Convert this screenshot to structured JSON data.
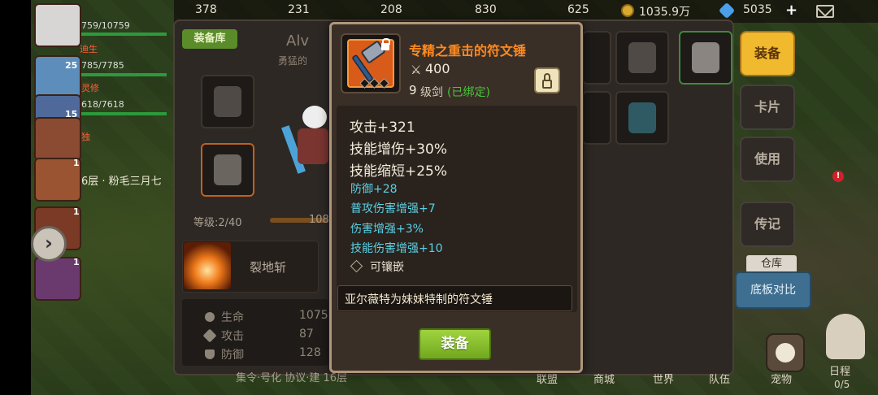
{
  "resources": [
    {
      "name": "resource-1",
      "value": "378"
    },
    {
      "name": "resource-2",
      "value": "231"
    },
    {
      "name": "resource-3",
      "value": "208"
    },
    {
      "name": "resource-4",
      "value": "830"
    },
    {
      "name": "resource-5",
      "value": "625"
    },
    {
      "name": "gold",
      "value": "1035.9万"
    },
    {
      "name": "diamonds",
      "value": "5035"
    }
  ],
  "team": [
    {
      "level": "",
      "hp": "759/10759",
      "name": ""
    },
    {
      "level": "25",
      "hp": "785/7785",
      "name": ""
    },
    {
      "level": "",
      "hp": "618/7618",
      "name": ""
    },
    {
      "level": "15",
      "hp": "",
      "name": ""
    },
    {
      "level": "1",
      "hp": "",
      "name": ""
    },
    {
      "level": "1",
      "hp": "",
      "name": ""
    },
    {
      "level": "1",
      "hp": "",
      "name": ""
    }
  ],
  "team_labels": {
    "name1": "迪生",
    "name2": "灵修",
    "name3": "独"
  },
  "floor_text": "6层 · 粉毛三月七",
  "equip_window": {
    "tab_label": "装备库",
    "hero_name": "Alv",
    "hero_title": "勇猛的",
    "level_label": "等级:2/40",
    "level_extra": "108",
    "skill_name": "裂地斩",
    "stats": [
      {
        "label": "生命",
        "value": "1075"
      },
      {
        "label": "攻击",
        "value": "87"
      },
      {
        "label": "防御",
        "value": "128"
      }
    ],
    "marquee": "集令·号化 协议·建 16层"
  },
  "side_menu": {
    "equip": "装备",
    "card": "卡片",
    "use": "使用",
    "biography": "传记",
    "warehouse": "仓库",
    "compare": "底板对比",
    "alert": "!"
  },
  "bottom_nav": {
    "alliance": "联盟",
    "shop": "商城",
    "world": "世界",
    "team": "队伍",
    "pet": "宠物",
    "schedule": "日程",
    "schedule_count": "0/5"
  },
  "tooltip": {
    "item_name": "专精之重击的符文锤",
    "power_icon": "crossed-swords-icon",
    "power": "400",
    "level_num": "9",
    "level_type": "级剑",
    "bound": "(已绑定)",
    "main_stats": [
      "攻击+321",
      "技能增伤+30%",
      "技能缩短+25%"
    ],
    "sub_stats": [
      "防御+28",
      "普攻伤害增强+7",
      "伤害增强+3%",
      "技能伤害增强+10"
    ],
    "socket": "可镶嵌",
    "description": "亚尔薇特为妹妹特制的符文锤",
    "equip_button": "装备"
  },
  "colors": {
    "item_name": "#ff8a1f",
    "bound": "#49c43a",
    "sub_stat": "#5ad1e6",
    "equip_button": "#8bc234",
    "active_tab": "#f0b92e"
  }
}
